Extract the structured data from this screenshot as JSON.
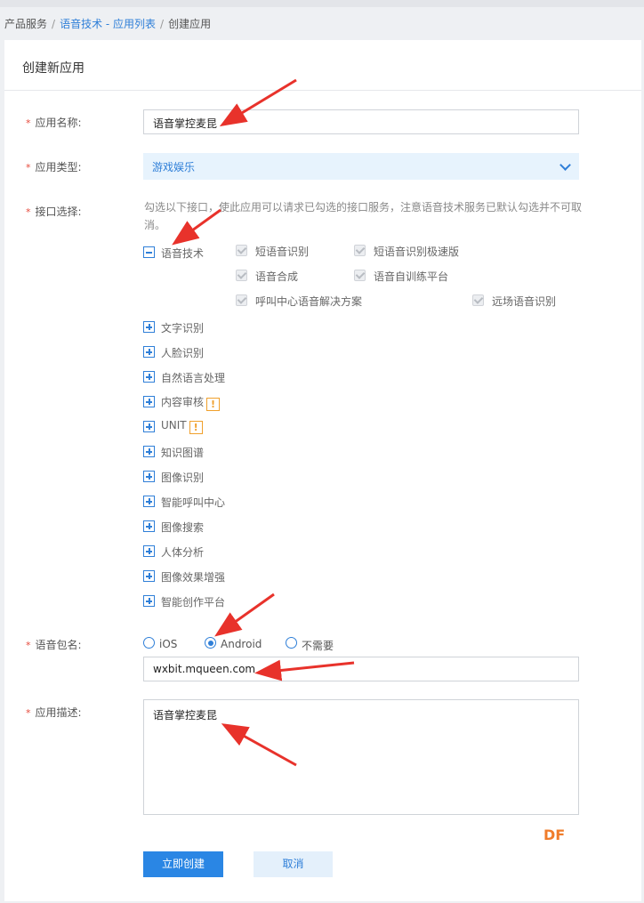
{
  "breadcrumb": {
    "root": "产品服务",
    "section": "语音技术 - 应用列表",
    "current": "创建应用"
  },
  "form": {
    "title": "创建新应用",
    "app_name": {
      "label": "应用名称:",
      "value": "语音掌控麦昆"
    },
    "app_type": {
      "label": "应用类型:",
      "value": "游戏娱乐"
    },
    "api_select": {
      "label": "接口选择:",
      "hint": "勾选以下接口，使此应用可以请求已勾选的接口服务，注意语音技术服务已默认勾选并不可取消。",
      "expanded": {
        "name": "语音技术",
        "subs": [
          "短语音识别",
          "短语音识别极速版",
          "语音合成",
          "语音自训练平台",
          "呼叫中心语音解决方案",
          "远场语音识别"
        ]
      },
      "categories": [
        "文字识别",
        "人脸识别",
        "自然语言处理",
        "内容审核",
        "UNIT",
        "知识图谱",
        "图像识别",
        "智能呼叫中心",
        "图像搜索",
        "人体分析",
        "图像效果增强",
        "智能创作平台"
      ],
      "warn_mark": "!"
    },
    "package": {
      "label": "语音包名:",
      "options": [
        "iOS",
        "Android",
        "不需要"
      ],
      "selected": "Android",
      "value": "wxbit.mqueen.com"
    },
    "description": {
      "label": "应用描述:",
      "value": "语音掌控麦昆"
    },
    "submit_label": "立即创建",
    "cancel_label": "取消"
  },
  "watermark": "DF",
  "colors": {
    "accent": "#2a86e4",
    "link": "#2f7fd8",
    "required": "#e64a3c",
    "warning": "#f0a02c",
    "annotation_arrow": "#e8322b"
  }
}
